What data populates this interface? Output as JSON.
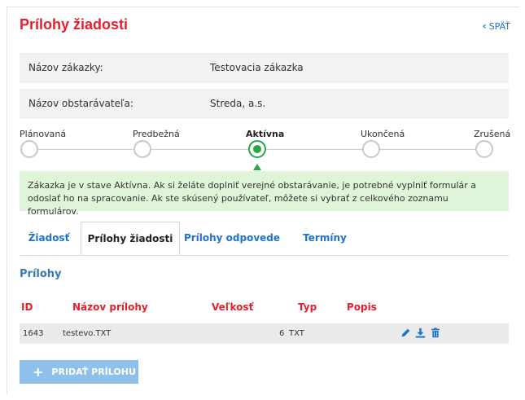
{
  "header": {
    "title": "Prílohy žiadosti",
    "back_label": "SPÄŤ"
  },
  "info": [
    {
      "label": "Názov zákazky:",
      "value": "Testovacia zákazka"
    },
    {
      "label": "Názov obstarávateľa:",
      "value": "Streda, a.s."
    }
  ],
  "stepper": {
    "steps": [
      "Plánovaná",
      "Predbežná",
      "Aktívna",
      "Ukončená",
      "Zrušená"
    ],
    "active": "Aktívna",
    "active_index": 2
  },
  "notice": "Zákazka je v stave Aktívna. Ak si želáte doplniť verejné obstarávanie, je potrebné vyplniť formulár a odoslať ho na spracovanie. Ak ste skúsený používateľ, môžete si vybrať z celkového zoznamu formulárov.",
  "tabs": [
    {
      "label": "Žiadosť"
    },
    {
      "label": "Prílohy žiadosti",
      "active": true
    },
    {
      "label": "Prílohy odpovede"
    },
    {
      "label": "Termíny"
    }
  ],
  "section_title": "Prílohy",
  "table": {
    "headers": [
      "ID",
      "Názov prílohy",
      "Veľkosť",
      "Typ",
      "Popis"
    ],
    "rows": [
      {
        "id": "1643",
        "name": "testevo.TXT",
        "size": "6",
        "type": "TXT",
        "description": ""
      }
    ]
  },
  "add_button_label": "PRIDAŤ PRÍLOHU",
  "colors": {
    "title": "#e5202e",
    "link": "#1f73c9",
    "active_step": "#28a745",
    "notice_bg": "#dff5d9",
    "button_bg": "#8ec0ea",
    "section_title": "#3a78b5"
  },
  "icons": [
    "chevron-left-icon",
    "pencil-icon",
    "download-icon",
    "trash-icon",
    "plus-icon"
  ]
}
